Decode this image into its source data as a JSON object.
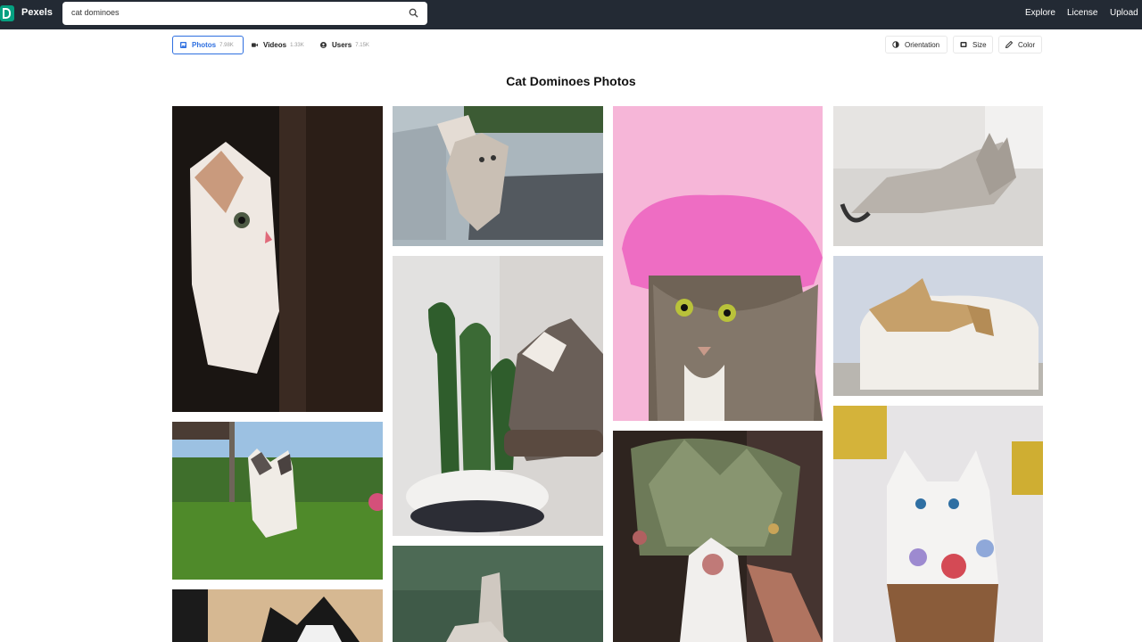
{
  "nav": {
    "brand": "Pexels",
    "search_value": "cat dominoes",
    "links": [
      "Explore",
      "License",
      "Upload"
    ]
  },
  "tabs": [
    {
      "label": "Photos",
      "count": "7.98K"
    },
    {
      "label": "Videos",
      "count": "1.33K"
    },
    {
      "label": "Users",
      "count": "7.15K"
    }
  ],
  "filters": [
    "Orientation",
    "Size",
    "Color"
  ],
  "page_title": "Cat Dominoes Photos",
  "colors": {
    "topbar": "#232A34",
    "brand_green": "#05A081",
    "active_tab": "#2E6FE0"
  }
}
